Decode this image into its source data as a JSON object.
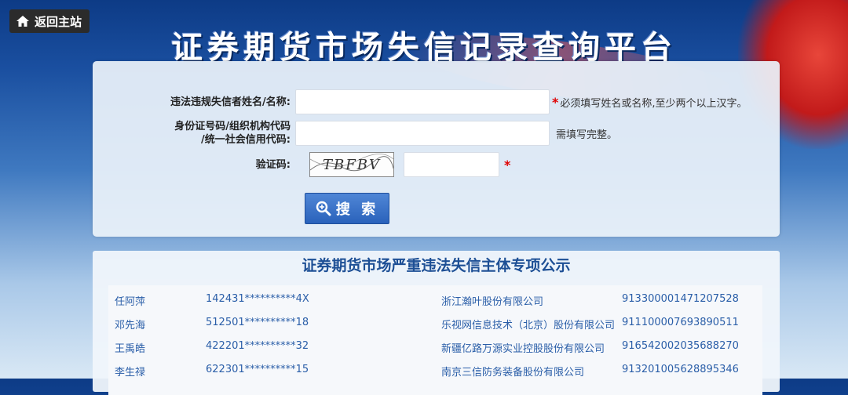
{
  "nav": {
    "home_label": "返回主站"
  },
  "header": {
    "title": "证券期货市场失信记录查询平台"
  },
  "form": {
    "name_label": "违法违规失信者姓名/名称:",
    "name_hint": "必须填写姓名或名称,至少两个以上汉字。",
    "id_label_line1": "身份证号码/组织机构代码",
    "id_label_line2": "/统一社会信用代码:",
    "id_hint": "需填写完整。",
    "captcha_label": "验证码:",
    "captcha_text": "TBFBV",
    "required_mark": "*",
    "search_label": "搜 索"
  },
  "public": {
    "title": "证券期货市场严重违法失信主体专项公示",
    "rows": [
      {
        "person": "任阿萍",
        "person_id": "142431**********4X",
        "company": "浙江瀚叶股份有限公司",
        "company_code": "913300001471207528"
      },
      {
        "person": "邓先海",
        "person_id": "512501**********18",
        "company": "乐视网信息技术（北京）股份有限公司",
        "company_code": "911100007693890511"
      },
      {
        "person": "王禹皓",
        "person_id": "422201**********32",
        "company": "新疆亿路万源实业控股股份有限公司",
        "company_code": "916542002035688270"
      },
      {
        "person": "李生禄",
        "person_id": "622301**********15",
        "company": "南京三信防务装备股份有限公司",
        "company_code": "913201005628895346"
      }
    ]
  },
  "colors": {
    "accent": "#2a62bb",
    "link": "#2a5ea8",
    "required": "#e00000"
  }
}
